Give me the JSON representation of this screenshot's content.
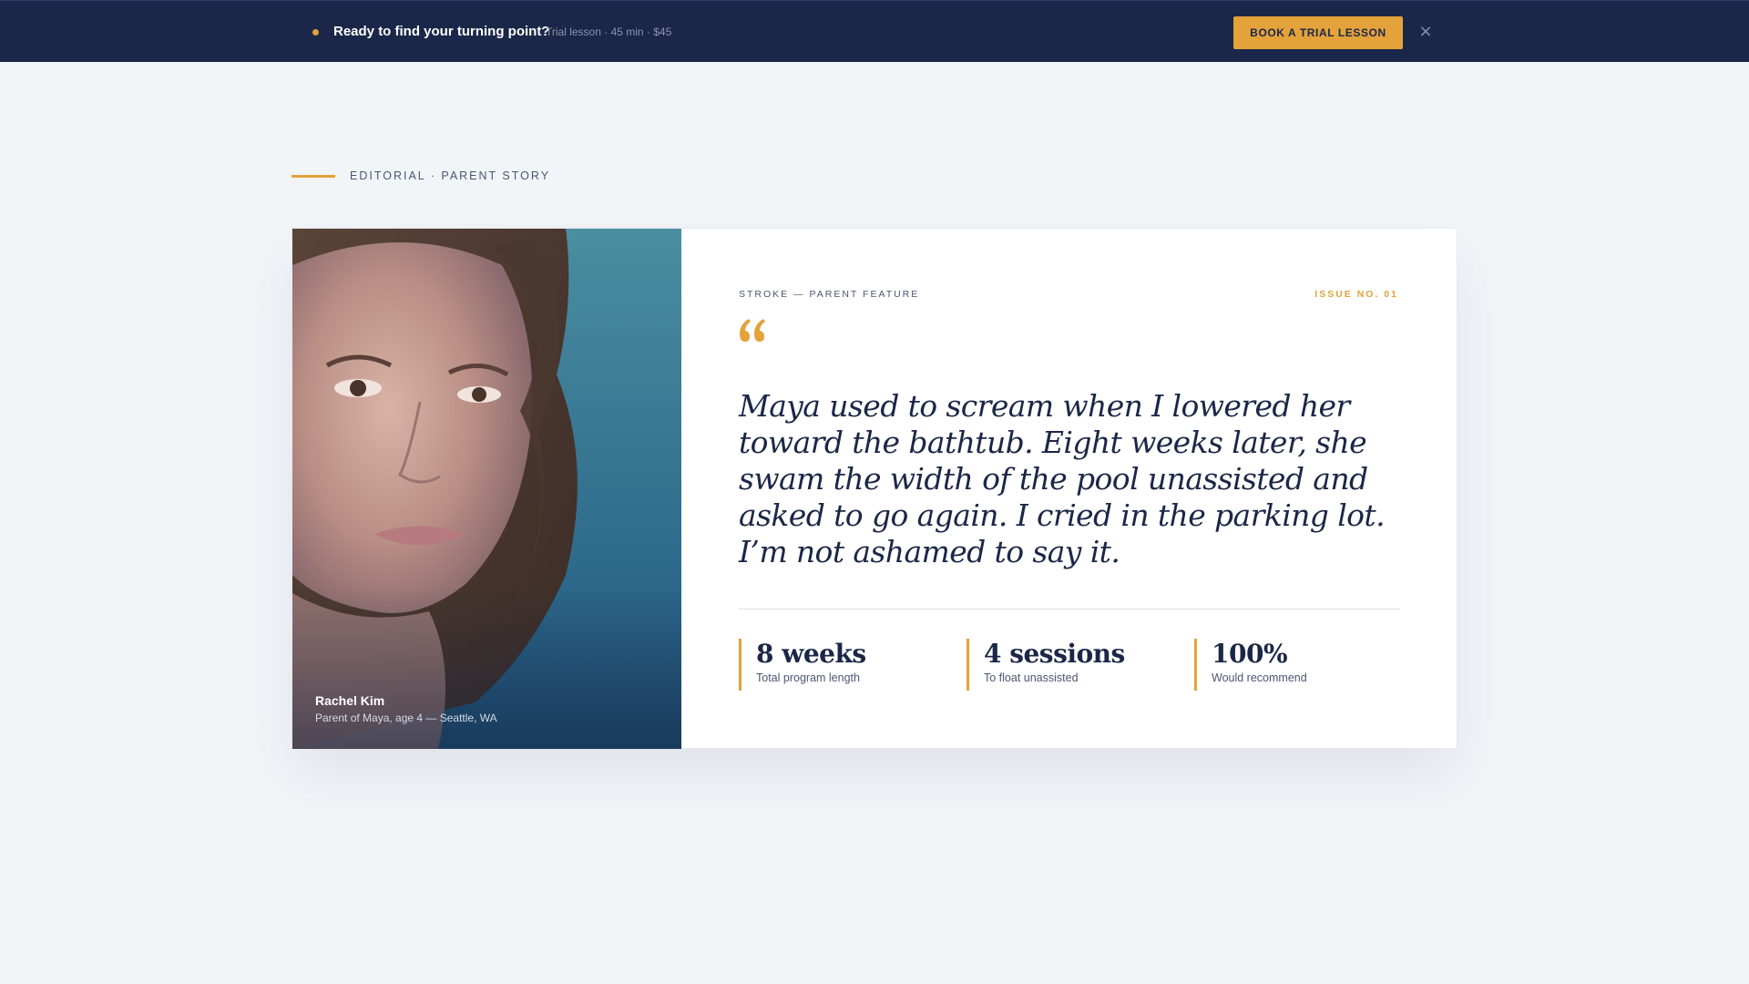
{
  "promo_bar": {
    "headline": "Ready to find your turning point?",
    "meta": "Trial lesson · 45 min · $45",
    "cta_label": "BOOK A TRIAL LESSON",
    "close_glyph": "×",
    "accent_color": "#e3a23a",
    "background_color": "#1b2748"
  },
  "eyebrow": {
    "text": "EDITORIAL · PARENT STORY"
  },
  "feature": {
    "kicker": "STROKE — PARENT FEATURE",
    "issue": "ISSUE NO. 01",
    "quote_icon": "quote-open-icon",
    "quote": "Maya used to scream when I lowered her toward the bathtub. Eight weeks later, she swam the width of the pool unassisted and asked to go again. I cried in the parking lot. I’m not ashamed to say it.",
    "photo": {
      "name": "Rachel Kim",
      "caption": "Parent of Maya, age 4 — Seattle, WA"
    },
    "stats": [
      {
        "value": "8 weeks",
        "label": "Total program length"
      },
      {
        "value": "4 sessions",
        "label": "To float unassisted"
      },
      {
        "value": "100%",
        "label": "Would recommend"
      }
    ]
  }
}
